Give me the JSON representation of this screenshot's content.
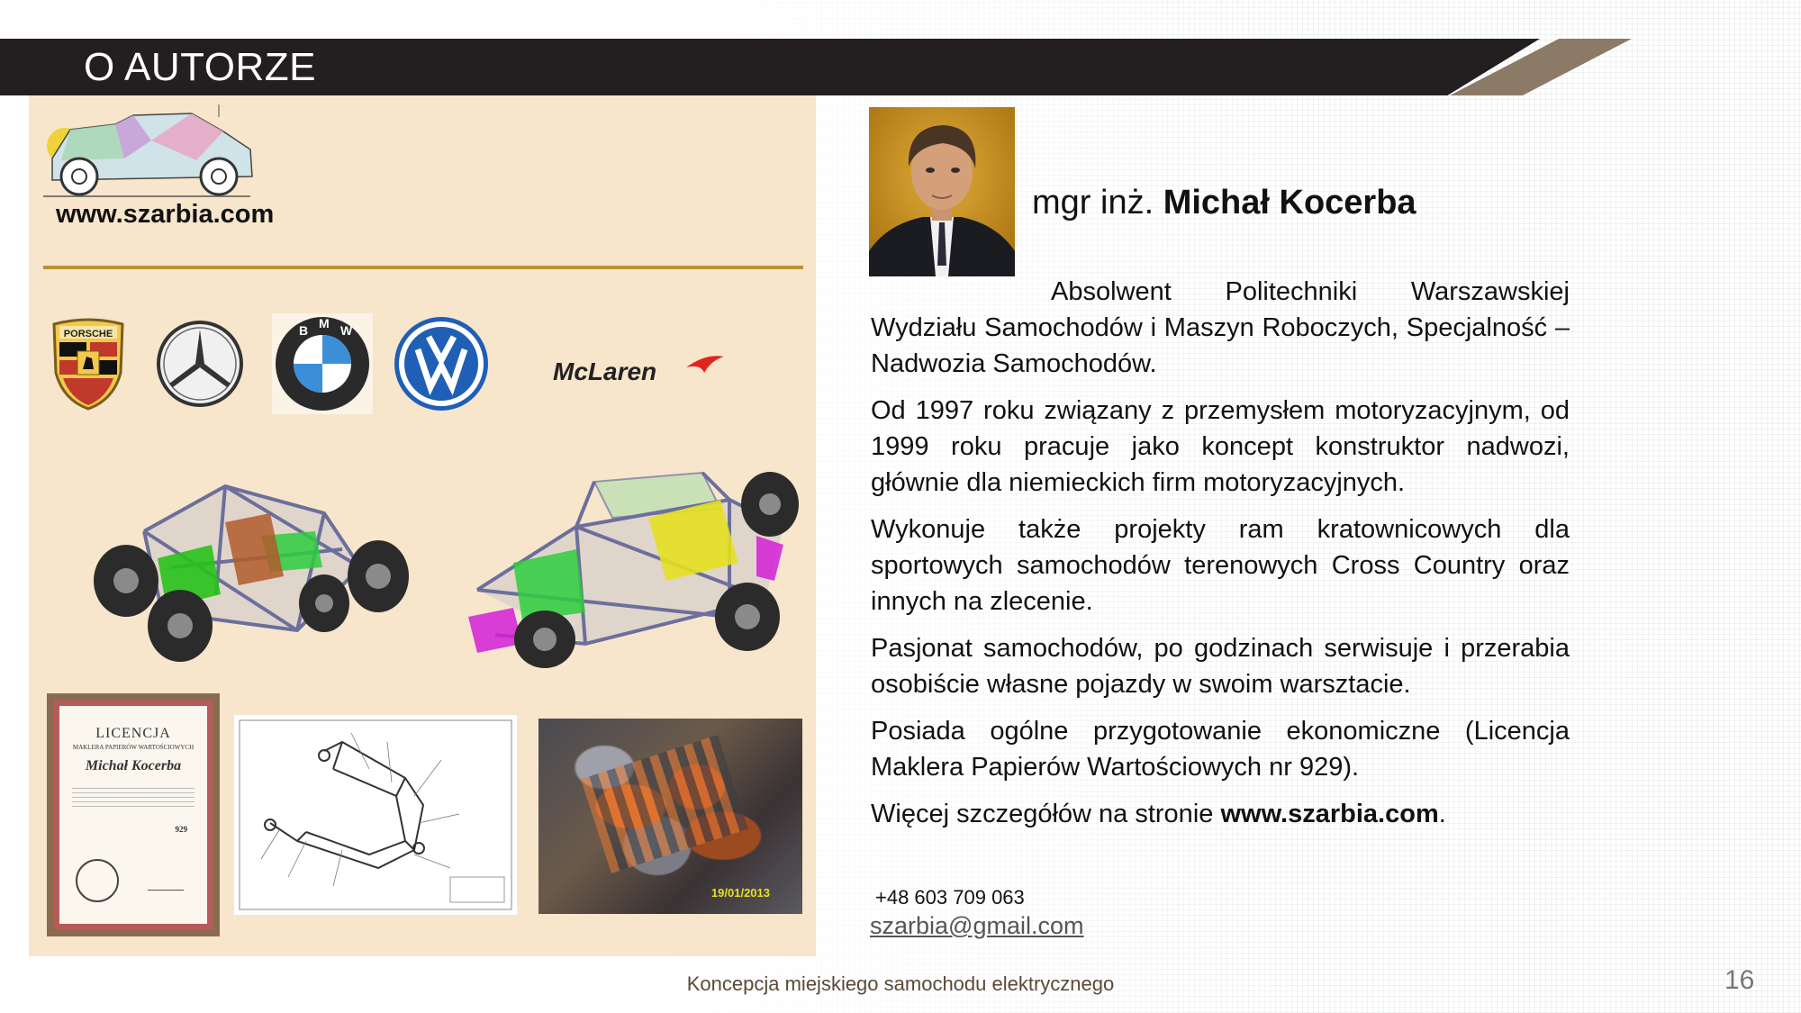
{
  "header": {
    "title": "O AUTORZE"
  },
  "left": {
    "site": "www.szarbia.com",
    "brands": [
      "Porsche",
      "Mercedes-Benz",
      "BMW",
      "Volkswagen",
      "McLaren"
    ],
    "mclaren_text": "McLaren",
    "bmw_letters": [
      "B",
      "M",
      "W"
    ],
    "porsche_text": "PORSCHE",
    "certificate": {
      "title": "LICENCJA",
      "subtitle": "MAKLERA PAPIERÓW WARTOŚCIOWYCH",
      "name": "Michał Kocerba",
      "number": "929"
    },
    "engine_date": "19/01/2013"
  },
  "author": {
    "prefix": "mgr inż. ",
    "name": "Michał Kocerba",
    "bio": [
      "Absolwent Politechniki Warszawskiej Wydziału Samochodów i Maszyn Roboczych, Specjalność – Nadwozia Samochodów.",
      "Od 1997 roku związany z przemysłem motoryzacyjnym, od 1999 roku pracuje jako koncept konstruktor nadwozi, głównie dla niemieckich firm motoryzacyjnych.",
      "Wykonuje także projekty ram kratownicowych dla sportowych samochodów terenowych Cross Country oraz innych na zlecenie.",
      "Pasjonat samochodów, po godzinach serwisuje i przerabia osobiście własne pojazdy w swoim warsztacie.",
      "Posiada ogólne przygotowanie ekonomiczne (Licencja Maklera Papierów Wartościowych nr 929)."
    ],
    "more_prefix": "Więcej szczegółów na stronie ",
    "more_link": "www.szarbia.com",
    "more_suffix": ".",
    "phone": "+48 603 709 063",
    "email": "szarbia@gmail.com"
  },
  "footer": {
    "caption": "Koncepcja miejskiego samochodu elektrycznego",
    "page": "16"
  },
  "colors": {
    "title_bar": "#231f20",
    "accent": "#8a7a66",
    "panel": "#f7e6cc",
    "divider": "#b89336"
  }
}
